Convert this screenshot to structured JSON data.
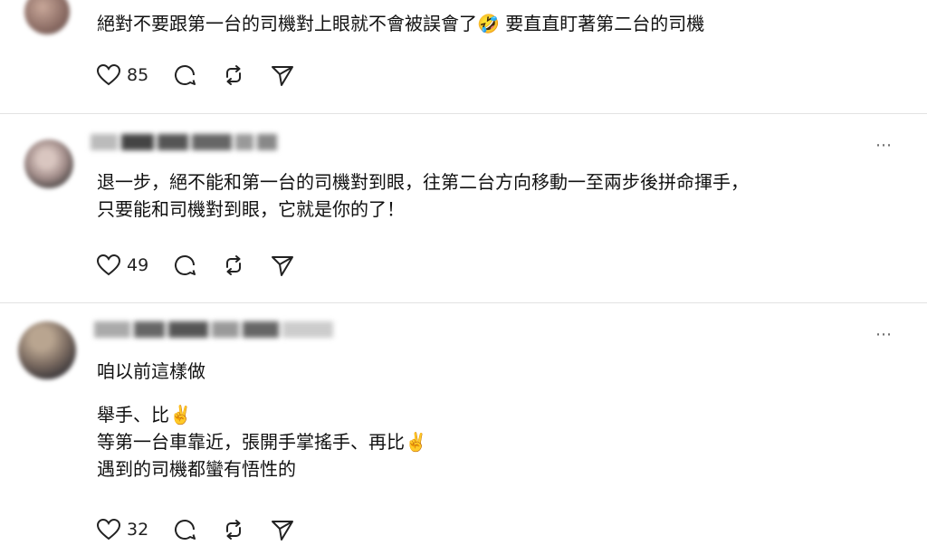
{
  "comments": [
    {
      "lines": [
        "絕對不要跟第一台的司機對上眼就不會被誤會了🤣 要直直盯著第二台的司機"
      ],
      "likes": "85",
      "more": "⋯"
    },
    {
      "lines": [
        "退一步，絕不能和第一台的司機對到眼，往第二台方向移動一至兩步後拼命揮手，",
        "只要能和司機對到眼，它就是你的了！"
      ],
      "likes": "49",
      "more": "⋯"
    },
    {
      "first_line": "咱以前這樣做",
      "lines": [
        "舉手、比✌️",
        "等第一台車靠近，張開手掌搖手、再比✌️",
        "遇到的司機都蠻有悟性的"
      ],
      "likes": "32",
      "more": "⋯"
    }
  ],
  "icons": {
    "like": "heart-icon",
    "reply": "comment-icon",
    "repost": "repost-icon",
    "share": "send-icon"
  },
  "colors": {
    "text": "#111111",
    "icon": "#222222",
    "divider": "#e2e2e2"
  }
}
